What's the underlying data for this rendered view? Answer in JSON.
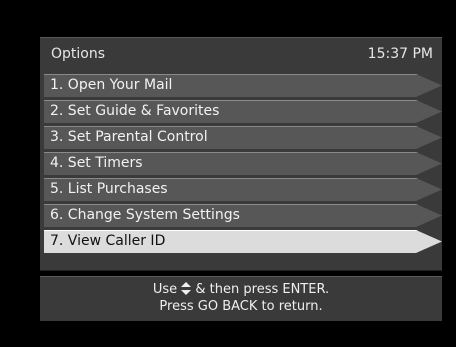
{
  "header": {
    "title": "Options",
    "time": "15:37 PM"
  },
  "menu": {
    "selected_index": 6,
    "items": [
      {
        "label": "1.  Open Your Mail"
      },
      {
        "label": "2.  Set Guide & Favorites"
      },
      {
        "label": "3.  Set Parental Control"
      },
      {
        "label": "4.  Set Timers"
      },
      {
        "label": "5.  List Purchases"
      },
      {
        "label": "6.  Change System Settings"
      },
      {
        "label": "7.  View Caller ID"
      }
    ]
  },
  "footer": {
    "line1_prefix": "Use",
    "line1_icon": "up-down-arrows-icon",
    "line1_suffix": "& then press ENTER.",
    "line2": "Press GO BACK to return."
  },
  "colors": {
    "panel": "#3a3a3a",
    "item": "#575757",
    "item_selected": "#dcdcdc",
    "background": "#000000"
  }
}
